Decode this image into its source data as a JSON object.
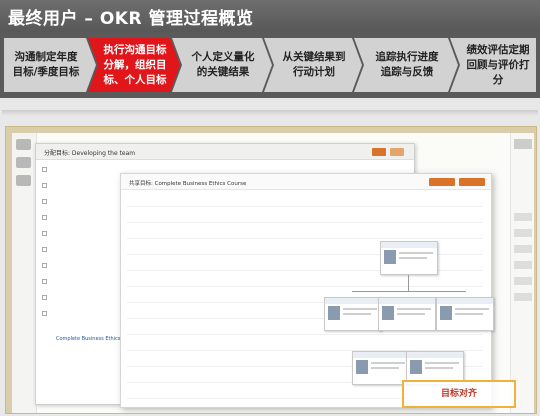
{
  "title": "最终用户 – OKR 管理过程概览",
  "steps": [
    {
      "label": "沟通制定年度目标/季度目标"
    },
    {
      "label": "执行沟通目标分解，组织目标、个人目标"
    },
    {
      "label": "个人定义量化的关键结果"
    },
    {
      "label": "从关键结果到行动计划"
    },
    {
      "label": "追踪执行进度追踪与反馈"
    },
    {
      "label": "绩效评估定期回顾与评价打分"
    }
  ],
  "colors": {
    "header_band": "#5a5a5a",
    "step_inactive": "#cfcfcf",
    "step_active": "#e0161b",
    "highlight_border": "#f0b23a",
    "highlight_text": "#c0392b",
    "accent_button": "#d9732a"
  },
  "screenshot": {
    "window1_title": "分配目标: Developing the team",
    "window2_title": "共享目标: Complete Business Ethics Course",
    "link_text": "Complete Business Ethics Course",
    "highlight_label": "目标对齐"
  }
}
